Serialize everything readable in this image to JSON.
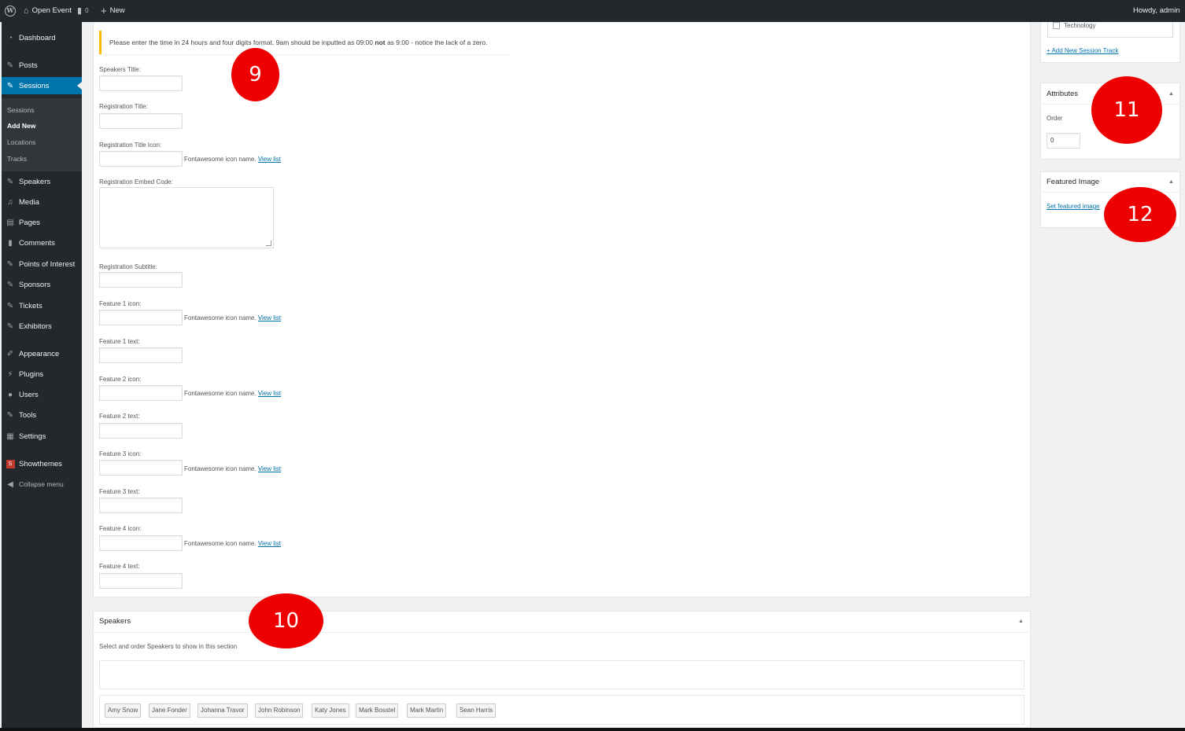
{
  "adminbar": {
    "site_name": "Open Event",
    "comments_count": "0",
    "new_label": "New",
    "greeting": "Howdy, admin"
  },
  "menu": {
    "items": [
      {
        "label": "Dashboard",
        "icon": "dashboard-icon"
      },
      {
        "label": "Posts",
        "icon": "pin-icon"
      },
      {
        "label": "Sessions",
        "icon": "pin-icon"
      },
      {
        "label": "Speakers",
        "icon": "pin-icon"
      },
      {
        "label": "Media",
        "icon": "media-icon"
      },
      {
        "label": "Pages",
        "icon": "pages-icon"
      },
      {
        "label": "Comments",
        "icon": "comments-icon"
      },
      {
        "label": "Points of Interest",
        "icon": "pin-icon"
      },
      {
        "label": "Sponsors",
        "icon": "pin-icon"
      },
      {
        "label": "Tickets",
        "icon": "pin-icon"
      },
      {
        "label": "Exhibitors",
        "icon": "pin-icon"
      },
      {
        "label": "Appearance",
        "icon": "brush-icon"
      },
      {
        "label": "Plugins",
        "icon": "plugin-icon"
      },
      {
        "label": "Users",
        "icon": "users-icon"
      },
      {
        "label": "Tools",
        "icon": "wrench-icon"
      },
      {
        "label": "Settings",
        "icon": "settings-icon"
      },
      {
        "label": "Showthemes",
        "icon": "showthemes-icon"
      },
      {
        "label": "Collapse menu",
        "icon": "collapse-icon"
      }
    ],
    "submenu": [
      "Sessions",
      "Add New",
      "Locations",
      "Tracks"
    ]
  },
  "notice": {
    "before": "Please enter the time in 24 hours and four digits format. 9am should be inputted as 09:00 ",
    "strong": "not",
    "after": " as 9:00 - notice the lack of a zero."
  },
  "form": {
    "speakers_title": "Speakers Title:",
    "registration_title": "Registration Title:",
    "registration_title_icon": "Registration Title Icon:",
    "registration_embed_code": "Registration Embed Code:",
    "registration_subtitle": "Registration Subtitle:",
    "feature1_icon": "Feature 1 icon:",
    "feature1_text": "Feature 1 text:",
    "feature2_icon": "Feature 2 icon:",
    "feature2_text": "Feature 2 text:",
    "feature3_icon": "Feature 3 icon:",
    "feature3_text": "Feature 3 text:",
    "feature4_icon": "Feature 4 icon:",
    "feature4_text": "Feature 4 text:",
    "icon_hint": "Fontawesome icon name. ",
    "view_list": "View list"
  },
  "speakers_box": {
    "title": "Speakers",
    "description": "Select and order Speakers to show in this section",
    "speakers": [
      "Amy Snow",
      "Jane Fonder",
      "Johanna Travor",
      "John Robinson",
      "Katy Jones",
      "Mark Bosstel",
      "Mark Martin",
      "Sean Harris"
    ]
  },
  "sidebar": {
    "track_option": "Technology",
    "add_track_link": "+ Add New Session Track",
    "attributes_title": "Attributes",
    "order_label": "Order",
    "order_value": "0",
    "featured_title": "Featured Image",
    "set_featured_link": "Set featured image"
  },
  "markers": [
    "9",
    "10",
    "11",
    "12"
  ],
  "colors": {
    "admin_dark": "#23282d",
    "submenu_bg": "#32373c",
    "accent": "#0073aa",
    "notice_warning": "#ffb900",
    "marker_red": "#ee0000"
  }
}
